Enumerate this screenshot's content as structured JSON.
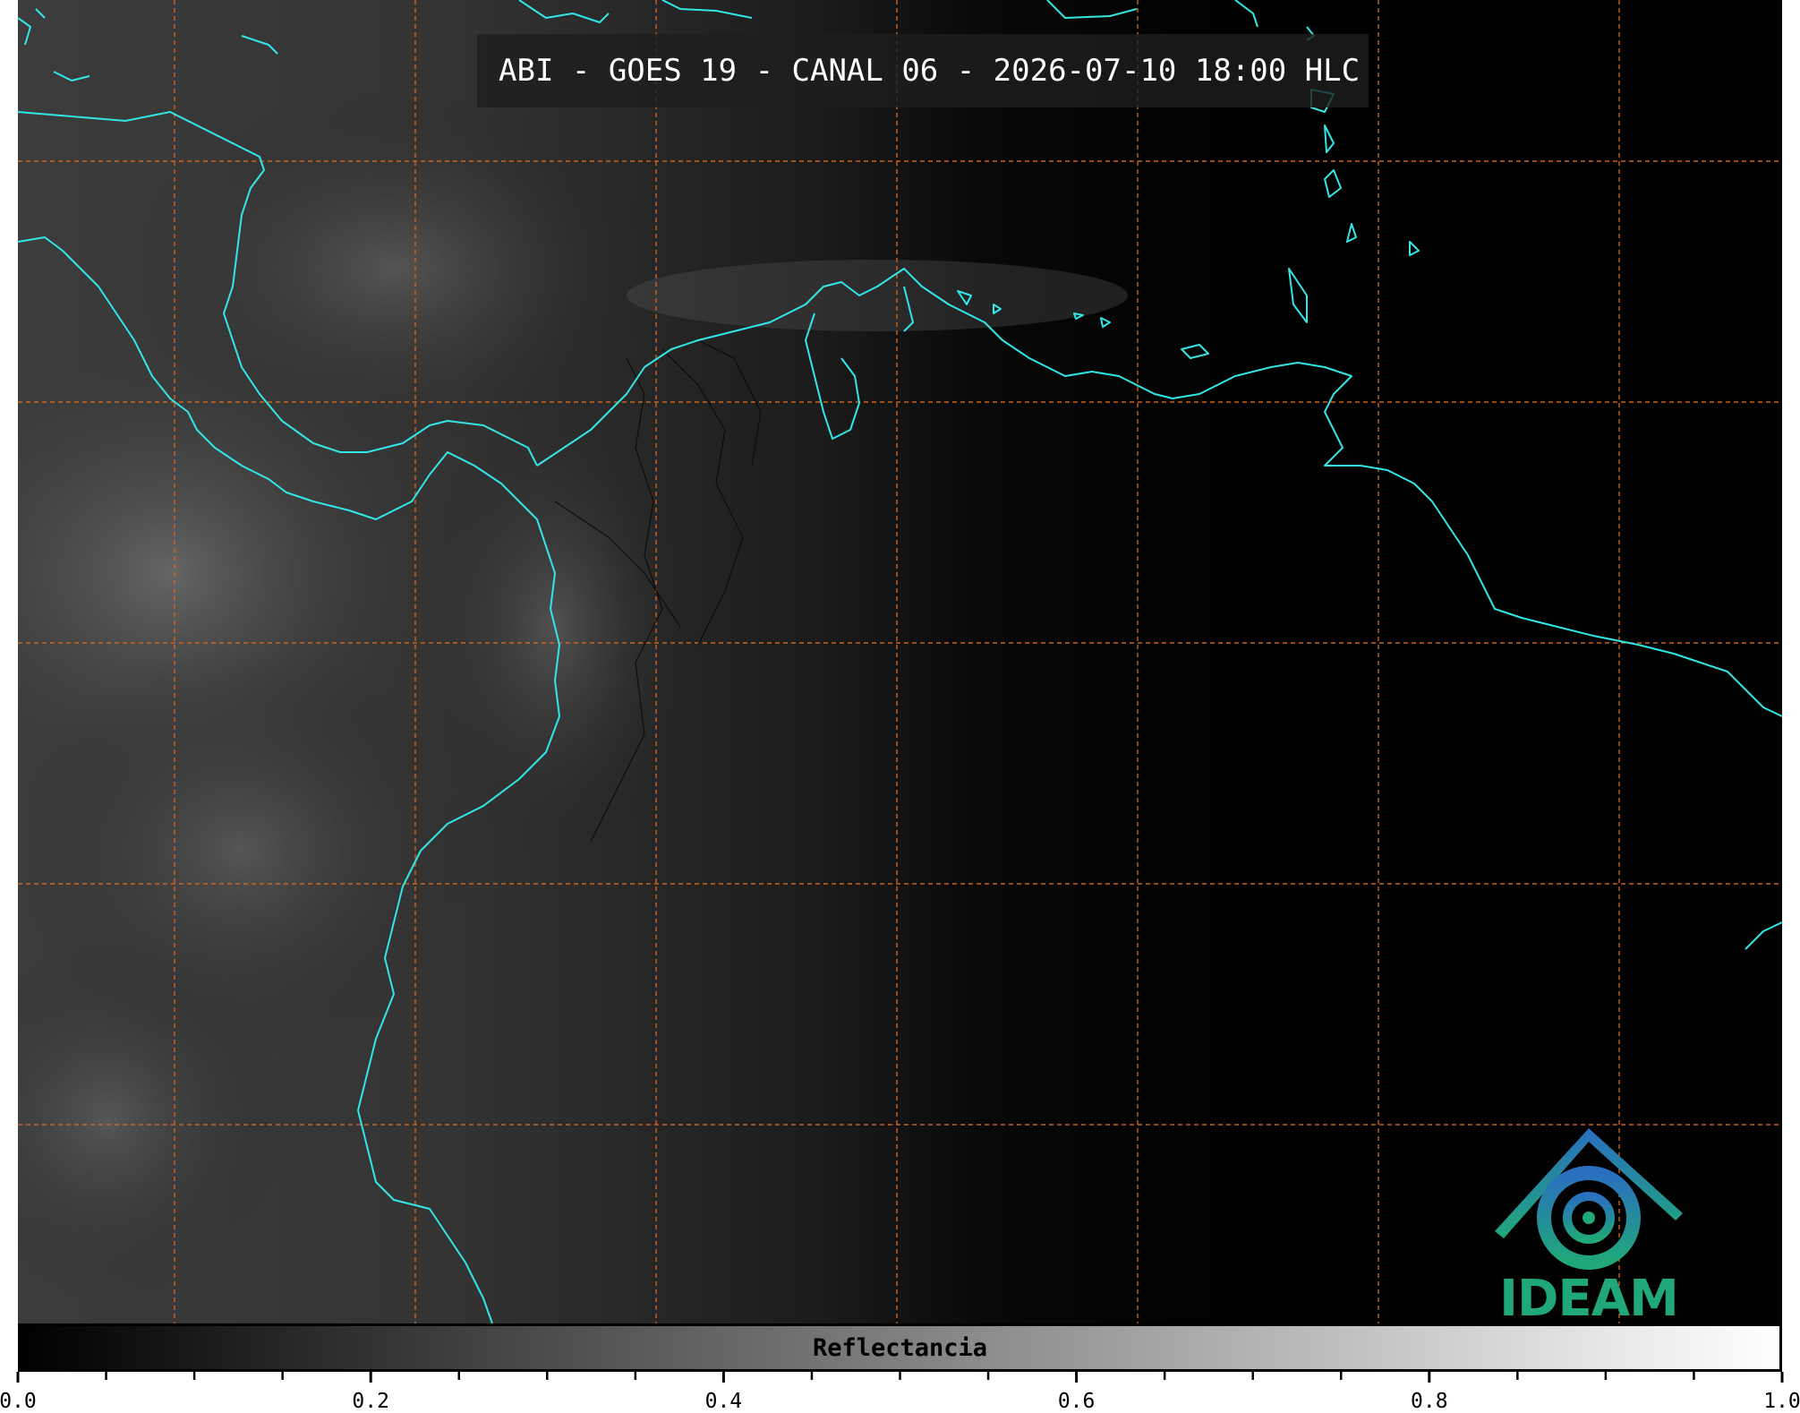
{
  "title": "ABI - GOES 19 - CANAL 06 - 2026-07-10 18:00 HLC",
  "logo": {
    "text": "IDEAM",
    "icon": "ideam-logo-icon"
  },
  "colorbar": {
    "label": "Reflectancia",
    "range": [
      0.0,
      1.0
    ],
    "tick_labels": [
      "0.0",
      "0.2",
      "0.4",
      "0.6",
      "0.8",
      "1.0"
    ],
    "colormap": "grayscale"
  },
  "colors": {
    "coastline": "#33e6e6",
    "gridline": "#d2691e",
    "background": "#000000"
  }
}
